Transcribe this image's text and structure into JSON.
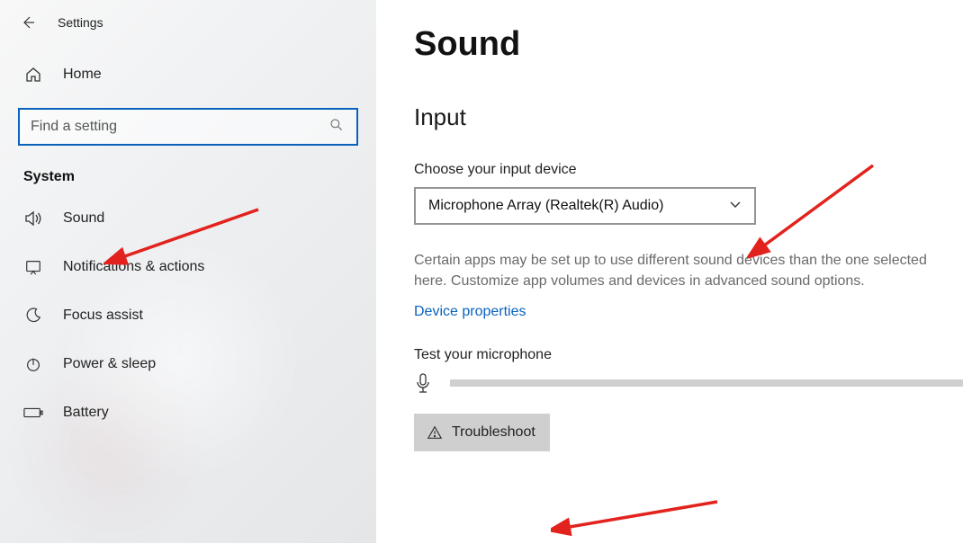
{
  "app": {
    "title": "Settings"
  },
  "sidebar": {
    "home_label": "Home",
    "search_placeholder": "Find a setting",
    "category_label": "System",
    "items": [
      {
        "label": "Sound"
      },
      {
        "label": "Notifications & actions"
      },
      {
        "label": "Focus assist"
      },
      {
        "label": "Power & sleep"
      },
      {
        "label": "Battery"
      }
    ]
  },
  "main": {
    "page_title": "Sound",
    "section_header": "Input",
    "input_device_label": "Choose your input device",
    "input_device_value": "Microphone Array (Realtek(R) Audio)",
    "help_text": "Certain apps may be set up to use different sound devices than the one selected here. Customize app volumes and devices in advanced sound options.",
    "device_properties_link": "Device properties",
    "test_mic_label": "Test your microphone",
    "troubleshoot_label": "Troubleshoot"
  }
}
